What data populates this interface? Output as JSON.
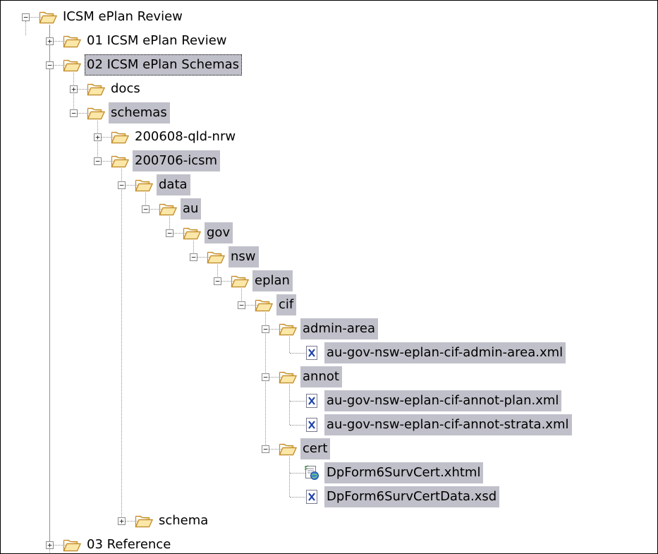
{
  "tree": {
    "items": [
      {
        "label": "ICSM ePlan Review",
        "depth": 0,
        "type": "folder",
        "toggle": "-",
        "selected": false,
        "focused": false
      },
      {
        "label": "01 ICSM ePlan Review",
        "depth": 1,
        "type": "folder",
        "toggle": "+",
        "selected": false,
        "focused": false
      },
      {
        "label": "02 ICSM ePlan Schemas",
        "depth": 1,
        "type": "folder",
        "toggle": "-",
        "selected": true,
        "focused": true
      },
      {
        "label": "docs",
        "depth": 2,
        "type": "folder",
        "toggle": "+",
        "selected": false,
        "focused": false
      },
      {
        "label": "schemas",
        "depth": 2,
        "type": "folder",
        "toggle": "-",
        "selected": true,
        "focused": false
      },
      {
        "label": "200608-qld-nrw",
        "depth": 3,
        "type": "folder",
        "toggle": "+",
        "selected": false,
        "focused": false
      },
      {
        "label": "200706-icsm",
        "depth": 3,
        "type": "folder",
        "toggle": "-",
        "selected": true,
        "focused": false
      },
      {
        "label": "data",
        "depth": 4,
        "type": "folder",
        "toggle": "-",
        "selected": true,
        "focused": false
      },
      {
        "label": "au",
        "depth": 5,
        "type": "folder",
        "toggle": "-",
        "selected": true,
        "focused": false
      },
      {
        "label": "gov",
        "depth": 6,
        "type": "folder",
        "toggle": "-",
        "selected": true,
        "focused": false
      },
      {
        "label": "nsw",
        "depth": 7,
        "type": "folder",
        "toggle": "-",
        "selected": true,
        "focused": false
      },
      {
        "label": "eplan",
        "depth": 8,
        "type": "folder",
        "toggle": "-",
        "selected": true,
        "focused": false
      },
      {
        "label": "cif",
        "depth": 9,
        "type": "folder",
        "toggle": "-",
        "selected": true,
        "focused": false
      },
      {
        "label": "admin-area",
        "depth": 10,
        "type": "folder",
        "toggle": "-",
        "selected": true,
        "focused": false
      },
      {
        "label": "au-gov-nsw-eplan-cif-admin-area.xml",
        "depth": 11,
        "type": "xml",
        "toggle": "",
        "selected": true,
        "focused": false
      },
      {
        "label": "annot",
        "depth": 10,
        "type": "folder",
        "toggle": "-",
        "selected": true,
        "focused": false
      },
      {
        "label": "au-gov-nsw-eplan-cif-annot-plan.xml",
        "depth": 11,
        "type": "xml",
        "toggle": "",
        "selected": true,
        "focused": false
      },
      {
        "label": "au-gov-nsw-eplan-cif-annot-strata.xml",
        "depth": 11,
        "type": "xml",
        "toggle": "",
        "selected": true,
        "focused": false
      },
      {
        "label": "cert",
        "depth": 10,
        "type": "folder",
        "toggle": "-",
        "selected": true,
        "focused": false
      },
      {
        "label": "DpForm6SurvCert.xhtml",
        "depth": 11,
        "type": "xhtml",
        "toggle": "",
        "selected": true,
        "focused": false
      },
      {
        "label": "DpForm6SurvCertData.xsd",
        "depth": 11,
        "type": "xml",
        "toggle": "",
        "selected": true,
        "focused": false
      },
      {
        "label": "schema",
        "depth": 4,
        "type": "folder",
        "toggle": "+",
        "selected": false,
        "focused": false
      },
      {
        "label": "03 Reference",
        "depth": 1,
        "type": "folder",
        "toggle": "+",
        "selected": false,
        "focused": false
      }
    ]
  },
  "icons": {
    "folder": "open-folder-icon",
    "xml": "xml-file-icon",
    "xhtml": "xhtml-file-icon",
    "expand": "expand-plus-icon",
    "collapse": "collapse-minus-icon"
  },
  "colors": {
    "selection": "#c0c0ca",
    "folder_fill": "#f7d889",
    "folder_stroke": "#c08a28",
    "xml_x": "#1c3fa8"
  }
}
